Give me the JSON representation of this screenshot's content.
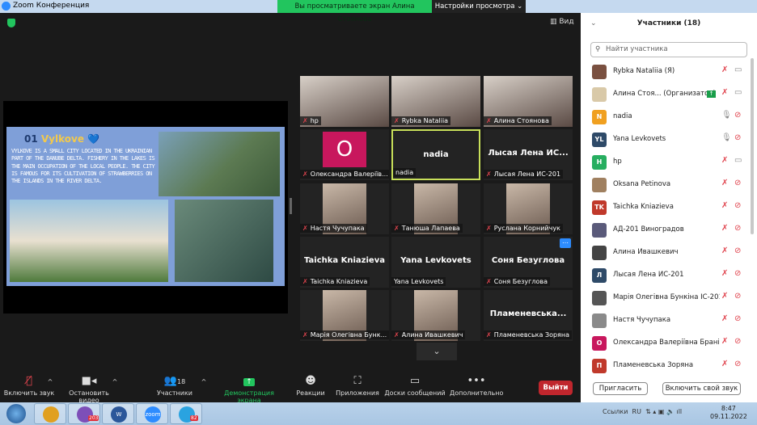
{
  "window": {
    "title": "Zoom Конференция"
  },
  "banner": {
    "text": "Вы просматриваете экран Алина Стоянова",
    "view_options": "Настройки просмотра ⌄"
  },
  "top": {
    "view_label": "Вид"
  },
  "slide": {
    "number": "01",
    "title": "Vylkove",
    "text": "Vylkove is a small city located in the Ukrainian part of the Danube delta. Fishery in the lakes is the main occupation of the local people. The city is famous for its cultivation of strawberries on the islands in the river delta."
  },
  "gallery": [
    {
      "label": "hp",
      "muted": true,
      "type": "video"
    },
    {
      "label": "Rybka Nataliia",
      "muted": true,
      "type": "video"
    },
    {
      "label": "Алина Стоянова",
      "muted": true,
      "type": "video"
    },
    {
      "label": "Олександра Валеріїв...",
      "muted": true,
      "type": "avatar",
      "avatar": "O"
    },
    {
      "label": "nadia",
      "muted": false,
      "type": "name",
      "big": "nadia",
      "active": true
    },
    {
      "label": "Лысая Лена ИС-201",
      "muted": true,
      "type": "name",
      "big": "Лысая Лена ИС..."
    },
    {
      "label": "Настя Чучупака",
      "muted": true,
      "type": "photo"
    },
    {
      "label": "Танюша Лапаева",
      "muted": true,
      "type": "photo"
    },
    {
      "label": "Руслана Корнийчук",
      "muted": true,
      "type": "photo"
    },
    {
      "label": "Taichka Kniazieva",
      "muted": true,
      "type": "name",
      "big": "Taichka Kniazieva"
    },
    {
      "label": "Yana Levkovets",
      "muted": false,
      "type": "name",
      "big": "Yana Levkovets"
    },
    {
      "label": "Соня Безуглова",
      "muted": true,
      "type": "name",
      "big": "Соня Безуглова"
    },
    {
      "label": "Марія Олегівна Бунк...",
      "muted": true,
      "type": "photo"
    },
    {
      "label": "Алина Ивашкевич",
      "muted": true,
      "type": "photo"
    },
    {
      "label": "Пламеневська Зоряна",
      "muted": true,
      "type": "name",
      "big": "Пламеневська..."
    }
  ],
  "toolbar": {
    "unmute": "Включить звук",
    "stop_video": "Остановить видео",
    "participants": "Участники",
    "participants_count": "18",
    "share": "Демонстрация экрана",
    "reactions": "Реакции",
    "apps": "Приложения",
    "whiteboards": "Доски сообщений",
    "more": "Дополнительно",
    "leave": "Выйти"
  },
  "panel": {
    "title": "Участники (18)",
    "search_placeholder": "Найти участника",
    "participants": [
      {
        "name": "Rybka Nataliia (Я)",
        "avatar": "",
        "color": "#7a5040",
        "mic": "muted",
        "cam": "on"
      },
      {
        "name": "Алина Стоя... (Организатор)",
        "avatar": "",
        "color": "#d9c9a8",
        "mic": "muted",
        "cam": "on",
        "sharing": true
      },
      {
        "name": "nadia",
        "avatar": "N",
        "color": "#f0a020",
        "mic": "on",
        "cam": "off"
      },
      {
        "name": "Yana Levkovets",
        "avatar": "YL",
        "color": "#2e4a68",
        "mic": "on",
        "cam": "off"
      },
      {
        "name": "hp",
        "avatar": "H",
        "color": "#27ae60",
        "mic": "muted",
        "cam": "on"
      },
      {
        "name": "Oksana Petinova",
        "avatar": "",
        "color": "#a08060",
        "mic": "muted",
        "cam": "off"
      },
      {
        "name": "Taichka Kniazieva",
        "avatar": "TK",
        "color": "#c0392b",
        "mic": "muted",
        "cam": "off"
      },
      {
        "name": "АД-201 Виноградов",
        "avatar": "",
        "color": "#5a5a7a",
        "mic": "muted",
        "cam": "off"
      },
      {
        "name": "Алина Ивашкевич",
        "avatar": "",
        "color": "#444",
        "mic": "muted",
        "cam": "off"
      },
      {
        "name": "Лысая Лена ИС-201",
        "avatar": "Л",
        "color": "#2e4a68",
        "mic": "muted",
        "cam": "off"
      },
      {
        "name": "Марія Олегівна Бункіна ІС-201",
        "avatar": "",
        "color": "#555",
        "mic": "muted",
        "cam": "off"
      },
      {
        "name": "Настя Чучупака",
        "avatar": "",
        "color": "#8a8a8a",
        "mic": "muted",
        "cam": "off"
      },
      {
        "name": "Олександра Валеріївна Браніш",
        "avatar": "O",
        "color": "#c8175d",
        "mic": "muted",
        "cam": "off"
      },
      {
        "name": "Пламеневська Зоряна",
        "avatar": "П",
        "color": "#c0392b",
        "mic": "muted",
        "cam": "off"
      }
    ],
    "invite": "Пригласить",
    "unmute_me": "Включить свой звук"
  },
  "taskbar": {
    "apps": [
      {
        "name": "chrome",
        "color": "#e0a020"
      },
      {
        "name": "viber",
        "color": "#7d4fb8",
        "badge": "203"
      },
      {
        "name": "word",
        "color": "#2b579a",
        "text": "W"
      },
      {
        "name": "zoom",
        "color": "#2d8cff",
        "text": "zoom"
      },
      {
        "name": "telegram",
        "color": "#2aa3e0",
        "badge": "82"
      }
    ],
    "links": "Ссылки",
    "lang": "RU",
    "time": "8:47",
    "date": "09.11.2022"
  }
}
